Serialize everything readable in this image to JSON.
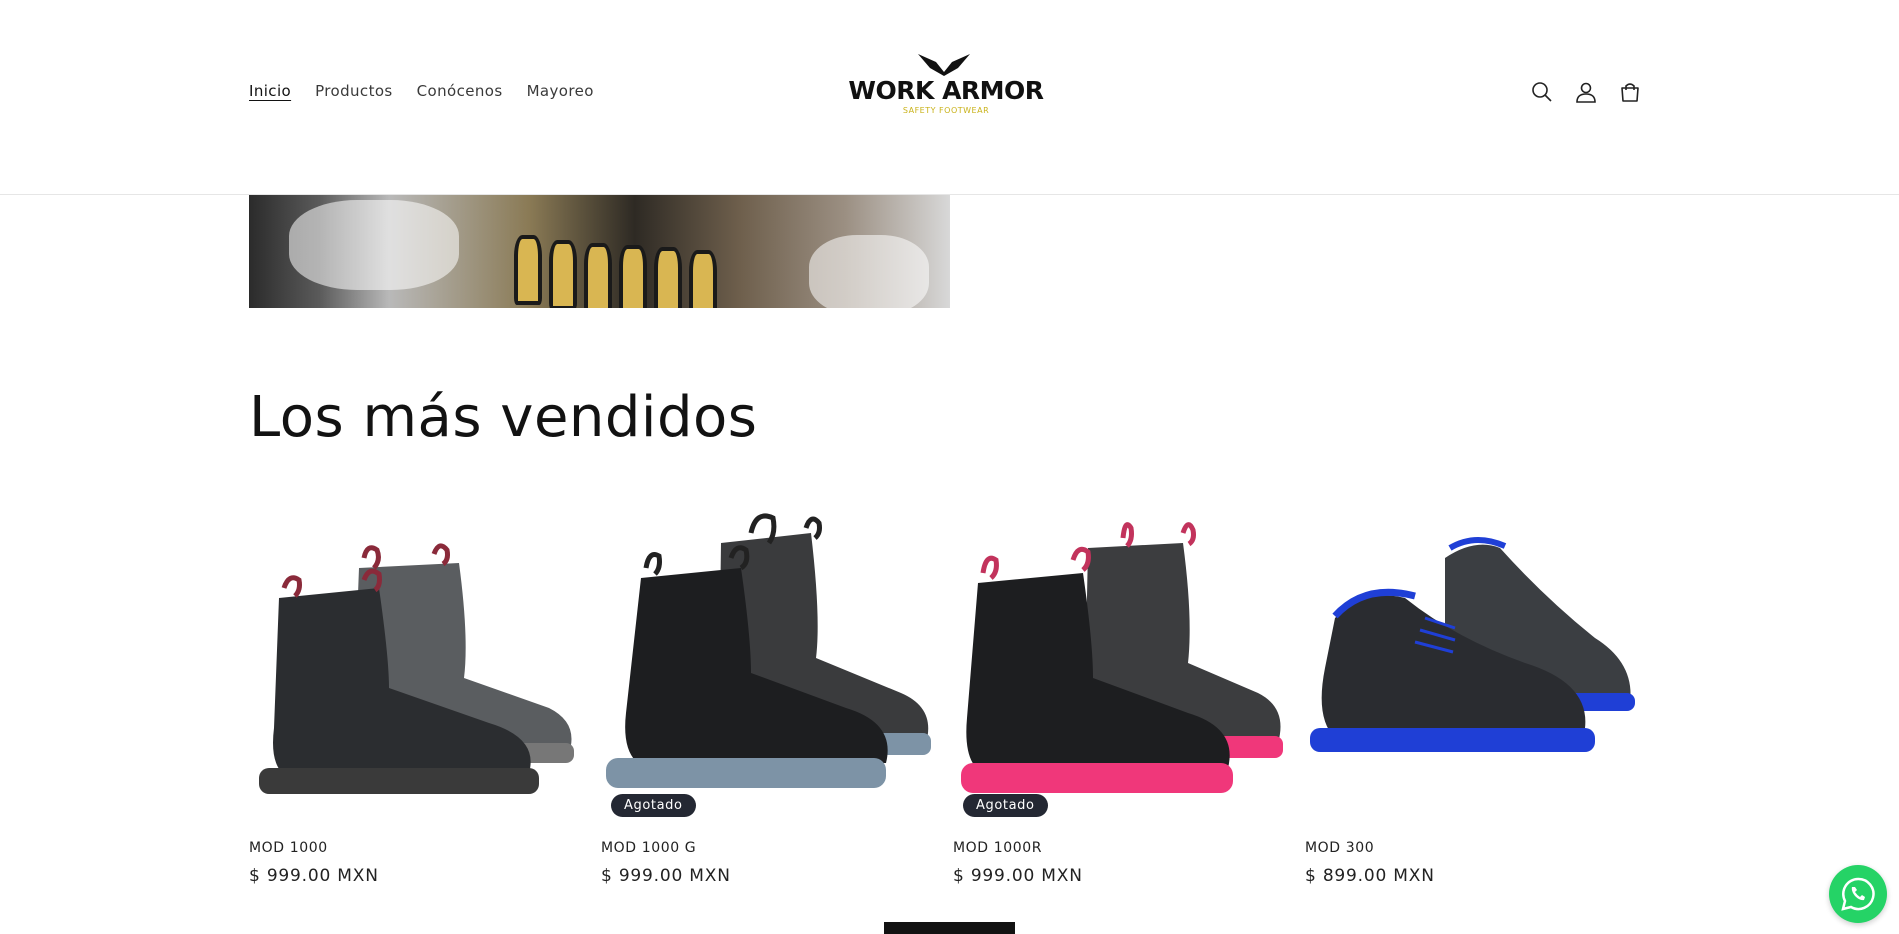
{
  "nav": {
    "items": [
      {
        "label": "Inicio",
        "active": true
      },
      {
        "label": "Productos",
        "active": false
      },
      {
        "label": "Conócenos",
        "active": false
      },
      {
        "label": "Mayoreo",
        "active": false
      }
    ]
  },
  "logo": {
    "title": "WORK ARMOR",
    "subtitle": "SAFETY FOOTWEAR"
  },
  "header_icons": [
    "search-icon",
    "account-icon",
    "cart-icon"
  ],
  "section": {
    "title": "Los más vendidos"
  },
  "products": [
    {
      "title": "MOD 1000",
      "price": "$ 999.00 MXN",
      "badge": "",
      "sole_color": "#555555",
      "pull_color": "#8a2a3a"
    },
    {
      "title": "MOD 1000 G",
      "price": "$ 999.00 MXN",
      "badge": "Agotado",
      "sole_color": "#7d93a6",
      "pull_color": "#222222"
    },
    {
      "title": "MOD 1000R",
      "price": "$ 999.00 MXN",
      "badge": "Agotado",
      "sole_color": "#f0377a",
      "pull_color": "#c2335c"
    },
    {
      "title": "MOD 300",
      "price": "$ 899.00 MXN",
      "badge": "",
      "sole_color": "#1f3fd6",
      "pull_color": "#1f3fd6"
    }
  ],
  "colors": {
    "badge_bg": "#242833",
    "whatsapp": "#25d366",
    "logo_accent": "#c9b21a"
  }
}
